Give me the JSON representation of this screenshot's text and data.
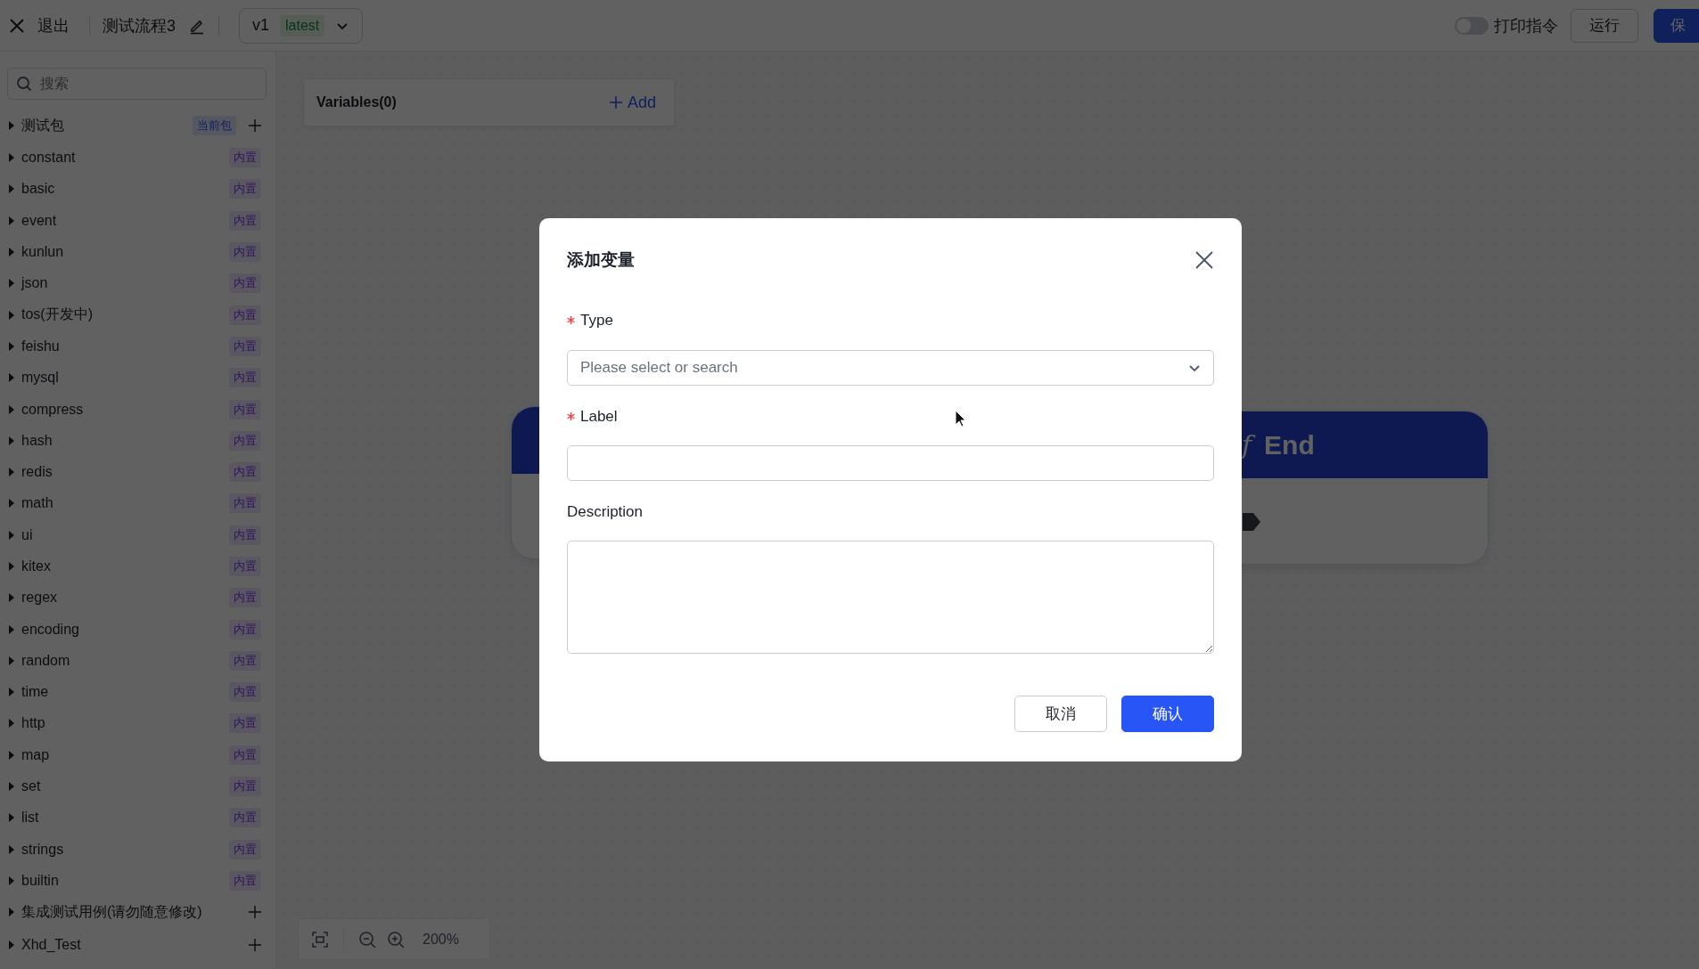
{
  "topbar": {
    "exit": {
      "label": "退出"
    },
    "flow_name": "测试流程3",
    "version": {
      "value": "v1",
      "tag": "latest"
    },
    "print_toggle": {
      "label": "打印指令",
      "on": false
    },
    "buttons": [
      {
        "label": "运行",
        "kind": "secondary"
      },
      {
        "label": "保",
        "kind": "primary"
      }
    ]
  },
  "sidebar": {
    "search": {
      "placeholder": "搜索"
    },
    "packages": [
      {
        "name": "测试包",
        "expanded": false,
        "tag": {
          "text": "当前包",
          "kind": "current"
        },
        "addable": true
      },
      {
        "name": "constant",
        "expanded": false,
        "tag": {
          "text": "内置",
          "kind": "builtin"
        },
        "addable": false
      },
      {
        "name": "basic",
        "expanded": false,
        "tag": {
          "text": "内置",
          "kind": "builtin"
        },
        "addable": false
      },
      {
        "name": "event",
        "expanded": false,
        "tag": {
          "text": "内置",
          "kind": "builtin"
        },
        "addable": false
      },
      {
        "name": "kunlun",
        "expanded": false,
        "tag": {
          "text": "内置",
          "kind": "builtin"
        },
        "addable": false
      },
      {
        "name": "json",
        "expanded": false,
        "tag": {
          "text": "内置",
          "kind": "builtin"
        },
        "addable": false
      },
      {
        "name": "tos(开发中)",
        "expanded": false,
        "tag": {
          "text": "内置",
          "kind": "builtin"
        },
        "addable": false
      },
      {
        "name": "feishu",
        "expanded": false,
        "tag": {
          "text": "内置",
          "kind": "builtin"
        },
        "addable": false
      },
      {
        "name": "mysql",
        "expanded": false,
        "tag": {
          "text": "内置",
          "kind": "builtin"
        },
        "addable": false
      },
      {
        "name": "compress",
        "expanded": false,
        "tag": {
          "text": "内置",
          "kind": "builtin"
        },
        "addable": false
      },
      {
        "name": "hash",
        "expanded": false,
        "tag": {
          "text": "内置",
          "kind": "builtin"
        },
        "addable": false
      },
      {
        "name": "redis",
        "expanded": false,
        "tag": {
          "text": "内置",
          "kind": "builtin"
        },
        "addable": false
      },
      {
        "name": "math",
        "expanded": false,
        "tag": {
          "text": "内置",
          "kind": "builtin"
        },
        "addable": false
      },
      {
        "name": "ui",
        "expanded": false,
        "tag": {
          "text": "内置",
          "kind": "builtin"
        },
        "addable": false
      },
      {
        "name": "kitex",
        "expanded": false,
        "tag": {
          "text": "内置",
          "kind": "builtin"
        },
        "addable": false
      },
      {
        "name": "regex",
        "expanded": false,
        "tag": {
          "text": "内置",
          "kind": "builtin"
        },
        "addable": false
      },
      {
        "name": "encoding",
        "expanded": false,
        "tag": {
          "text": "内置",
          "kind": "builtin"
        },
        "addable": false
      },
      {
        "name": "random",
        "expanded": false,
        "tag": {
          "text": "内置",
          "kind": "builtin"
        },
        "addable": false
      },
      {
        "name": "time",
        "expanded": false,
        "tag": {
          "text": "内置",
          "kind": "builtin"
        },
        "addable": false
      },
      {
        "name": "http",
        "expanded": false,
        "tag": {
          "text": "内置",
          "kind": "builtin"
        },
        "addable": false
      },
      {
        "name": "map",
        "expanded": false,
        "tag": {
          "text": "内置",
          "kind": "builtin"
        },
        "addable": false
      },
      {
        "name": "set",
        "expanded": false,
        "tag": {
          "text": "内置",
          "kind": "builtin"
        },
        "addable": false
      },
      {
        "name": "list",
        "expanded": false,
        "tag": {
          "text": "内置",
          "kind": "builtin"
        },
        "addable": false
      },
      {
        "name": "strings",
        "expanded": false,
        "tag": {
          "text": "内置",
          "kind": "builtin"
        },
        "addable": false
      },
      {
        "name": "builtin",
        "expanded": false,
        "tag": {
          "text": "内置",
          "kind": "builtin"
        },
        "addable": false
      },
      {
        "name": "集成测试用例(请勿随意修改)",
        "expanded": false,
        "addable": true
      },
      {
        "name": "Xhd_Test",
        "expanded": false,
        "addable": true
      }
    ]
  },
  "canvas": {
    "variables_panel": {
      "title": "Variables(0)",
      "add_label": "Add"
    },
    "nodes": [
      {
        "kind": "start"
      },
      {
        "kind": "end",
        "icon": "ƒ",
        "title": "End"
      }
    ],
    "zoom": "200%"
  },
  "modal": {
    "title": "添加变量",
    "fields": [
      {
        "label": "Type",
        "required": true,
        "kind": "select",
        "placeholder": "Please select or search"
      },
      {
        "label": "Label",
        "required": true,
        "kind": "input"
      },
      {
        "label": "Description",
        "required": false,
        "kind": "textarea"
      }
    ],
    "buttons": [
      {
        "label": "取消",
        "kind": "secondary"
      },
      {
        "label": "确认",
        "kind": "primary"
      }
    ]
  }
}
